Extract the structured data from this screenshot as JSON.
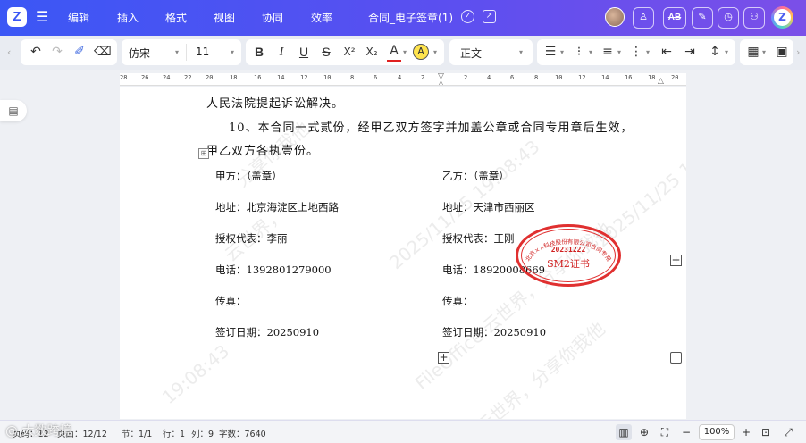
{
  "app": {
    "logo_letter": "Z",
    "menu_icon": "hamburger-icon"
  },
  "menu": {
    "items": [
      "编辑",
      "插入",
      "格式",
      "视图",
      "协同",
      "效率"
    ]
  },
  "document": {
    "title": "合同_电子签章(1)"
  },
  "topbar_right": {
    "ab_label": "AB"
  },
  "toolbar": {
    "font_name": "仿宋",
    "font_size": "11",
    "style": "正文",
    "bold": "B",
    "italic": "I",
    "underline": "U",
    "strike": "S",
    "superscript": "X²",
    "subscript": "X₂",
    "font_color": "A",
    "highlight": "A"
  },
  "ruler": {
    "left_labels": [
      "28",
      "26",
      "24",
      "22",
      "20",
      "18",
      "16",
      "14",
      "12",
      "10",
      "8",
      "6",
      "4",
      "2"
    ],
    "right_labels": [
      "2",
      "4",
      "6",
      "8",
      "10",
      "12",
      "14",
      "16",
      "18",
      "20"
    ]
  },
  "body": {
    "line1": "人民法院提起诉讼解决。",
    "line2": "10、本合同一式贰份，经甲乙双方签字并加盖公章或合同专用章后生效，",
    "line3": "甲乙双方各执壹份。"
  },
  "party_a": {
    "seal": "甲方：（盖章）",
    "address": "地址：北京海淀区上地西路",
    "rep": "授权代表：李丽",
    "phone": "电话：1392801279000",
    "fax": "传真：",
    "date": "签订日期：20250910"
  },
  "party_b": {
    "seal": "乙方：（盖章）",
    "address": "地址：天津市西丽区",
    "rep": "授权代表：王刚",
    "phone": "电话：18920008669",
    "fax": "传真：",
    "date": "签订日期：20250910"
  },
  "stamp": {
    "arc_text": "北京××科技股份有限公司合同专用章",
    "date": "20231222",
    "label": "SM2证书"
  },
  "watermark": {
    "text": "Fil...Office 云世界，分享你我他 2025/11/25 19:08:43"
  },
  "status": {
    "page": "页码：12",
    "pages": "页面：12/12",
    "section": "节：1/1",
    "row": "行：1",
    "col": "列：9",
    "words": "字数：7640",
    "zoom": "100%"
  },
  "bottom_overlay": "@ 大数跨境"
}
